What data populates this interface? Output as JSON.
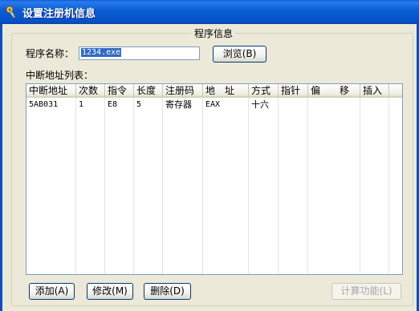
{
  "window": {
    "title": "设置注册机信息"
  },
  "group": {
    "title": "程序信息"
  },
  "program": {
    "label": "程序名称：",
    "value": "1234.exe",
    "browse_button": "浏览(B)"
  },
  "list": {
    "label": "中断地址列表：",
    "columns": [
      "中断地址",
      "次数",
      "指令",
      "长度",
      "注册码",
      "地　址",
      "方式",
      "指针",
      "偏　　移",
      "插入"
    ],
    "rows": [
      [
        "5AB031",
        "1",
        "E8",
        "5",
        "寄存器",
        "EAX",
        "十六",
        "",
        "",
        ""
      ]
    ]
  },
  "buttons": {
    "add": "添加(A)",
    "edit": "修改(M)",
    "delete": "删除(D)",
    "calc": "计算功能(L)"
  }
}
